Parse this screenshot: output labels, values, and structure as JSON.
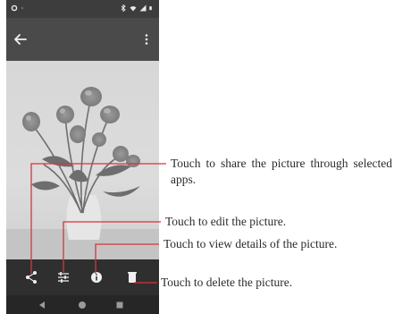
{
  "toolbar": {
    "back_icon": "arrow-back-icon",
    "menu_icon": "more-vert-icon"
  },
  "actions": [
    {
      "icon": "share-icon"
    },
    {
      "icon": "edit-icon"
    },
    {
      "icon": "info-icon"
    },
    {
      "icon": "delete-icon"
    }
  ],
  "nav": [
    {
      "icon": "nav-back-icon"
    },
    {
      "icon": "nav-home-icon"
    },
    {
      "icon": "nav-recents-icon"
    }
  ],
  "callouts": {
    "share": "Touch to share the picture through selected apps.",
    "edit": "Touch to edit the picture.",
    "details": "Touch to view details of the picture.",
    "delete": "Touch to delete the picture."
  },
  "colors": {
    "leader_line": "#d9323a",
    "bars": "#3d3d3d"
  }
}
